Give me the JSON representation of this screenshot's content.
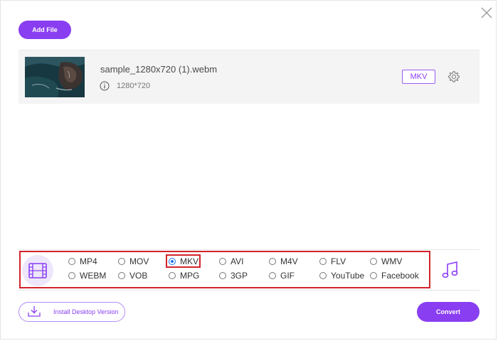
{
  "toolbar": {
    "add_file_label": "Add File",
    "close_icon": "close-icon"
  },
  "file": {
    "name": "sample_1280x720 (1).webm",
    "resolution": "1280*720",
    "format": "MKV",
    "info_icon": "info-icon",
    "settings_icon": "gear-icon"
  },
  "formats": {
    "video_tab_icon": "film-icon",
    "audio_tab_icon": "music-note-icon",
    "selected": "MKV",
    "row1": [
      "MP4",
      "MOV",
      "MKV",
      "AVI",
      "M4V",
      "FLV",
      "WMV"
    ],
    "row2": [
      "WEBM",
      "VOB",
      "MPG",
      "3GP",
      "GIF",
      "YouTube",
      "Facebook"
    ]
  },
  "footer": {
    "install_label": "Install Desktop Version",
    "install_icon": "download-icon",
    "convert_label": "Convert"
  },
  "colors": {
    "accent": "#8a3ef2",
    "highlight": "#d2232a",
    "radio_selected": "#1a73e8"
  }
}
